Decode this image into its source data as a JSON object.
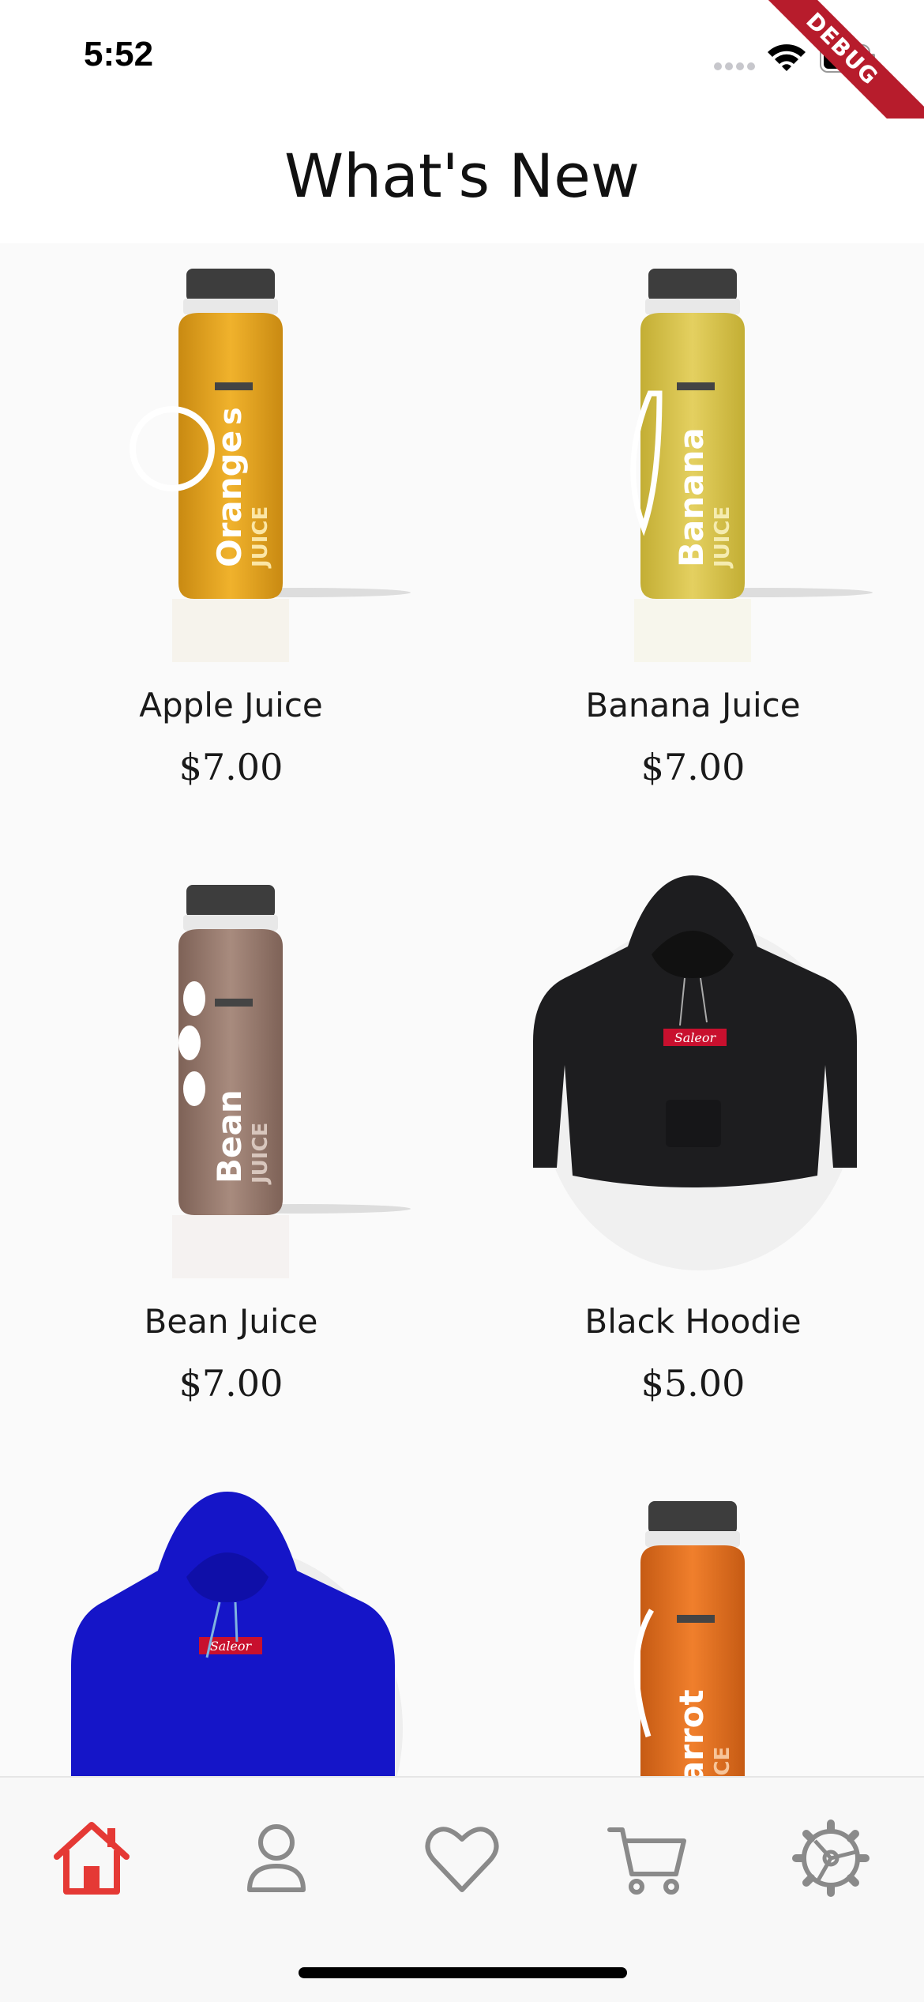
{
  "status_bar": {
    "time": "5:52",
    "debug_label": "DEBUG"
  },
  "header": {
    "title": "What's New"
  },
  "products": [
    {
      "name": "Apple Juice",
      "price": "$7.00",
      "image": "bottle-orange"
    },
    {
      "name": "Banana Juice",
      "price": "$7.00",
      "image": "bottle-banana"
    },
    {
      "name": "Bean Juice",
      "price": "$7.00",
      "image": "bottle-bean"
    },
    {
      "name": "Black Hoodie",
      "price": "$5.00",
      "image": "hoodie-black"
    },
    {
      "name": "",
      "price": "",
      "image": "hoodie-blue"
    },
    {
      "name": "",
      "price": "",
      "image": "bottle-carrot"
    }
  ],
  "product_labels": {
    "orange": "Orange",
    "banana": "Banana",
    "bean": "Bean",
    "carrot": "Carrot",
    "juice": "JUICE",
    "s_mark": "s",
    "hoodie_brand": "Saleor"
  },
  "bottom_nav": [
    {
      "icon": "home-icon",
      "active": true
    },
    {
      "icon": "user-icon",
      "active": false
    },
    {
      "icon": "heart-icon",
      "active": false
    },
    {
      "icon": "cart-icon",
      "active": false
    },
    {
      "icon": "settings-icon",
      "active": false
    }
  ],
  "colors": {
    "accent": "#e53935",
    "nav_inactive": "#8a8a8a",
    "orange_juice": "#e0a020",
    "banana_juice": "#d8c34a",
    "bean_juice": "#9c7a6c",
    "carrot_juice": "#e06e1f",
    "hoodie_black": "#1d1d1f",
    "hoodie_blue": "#1515c8"
  }
}
